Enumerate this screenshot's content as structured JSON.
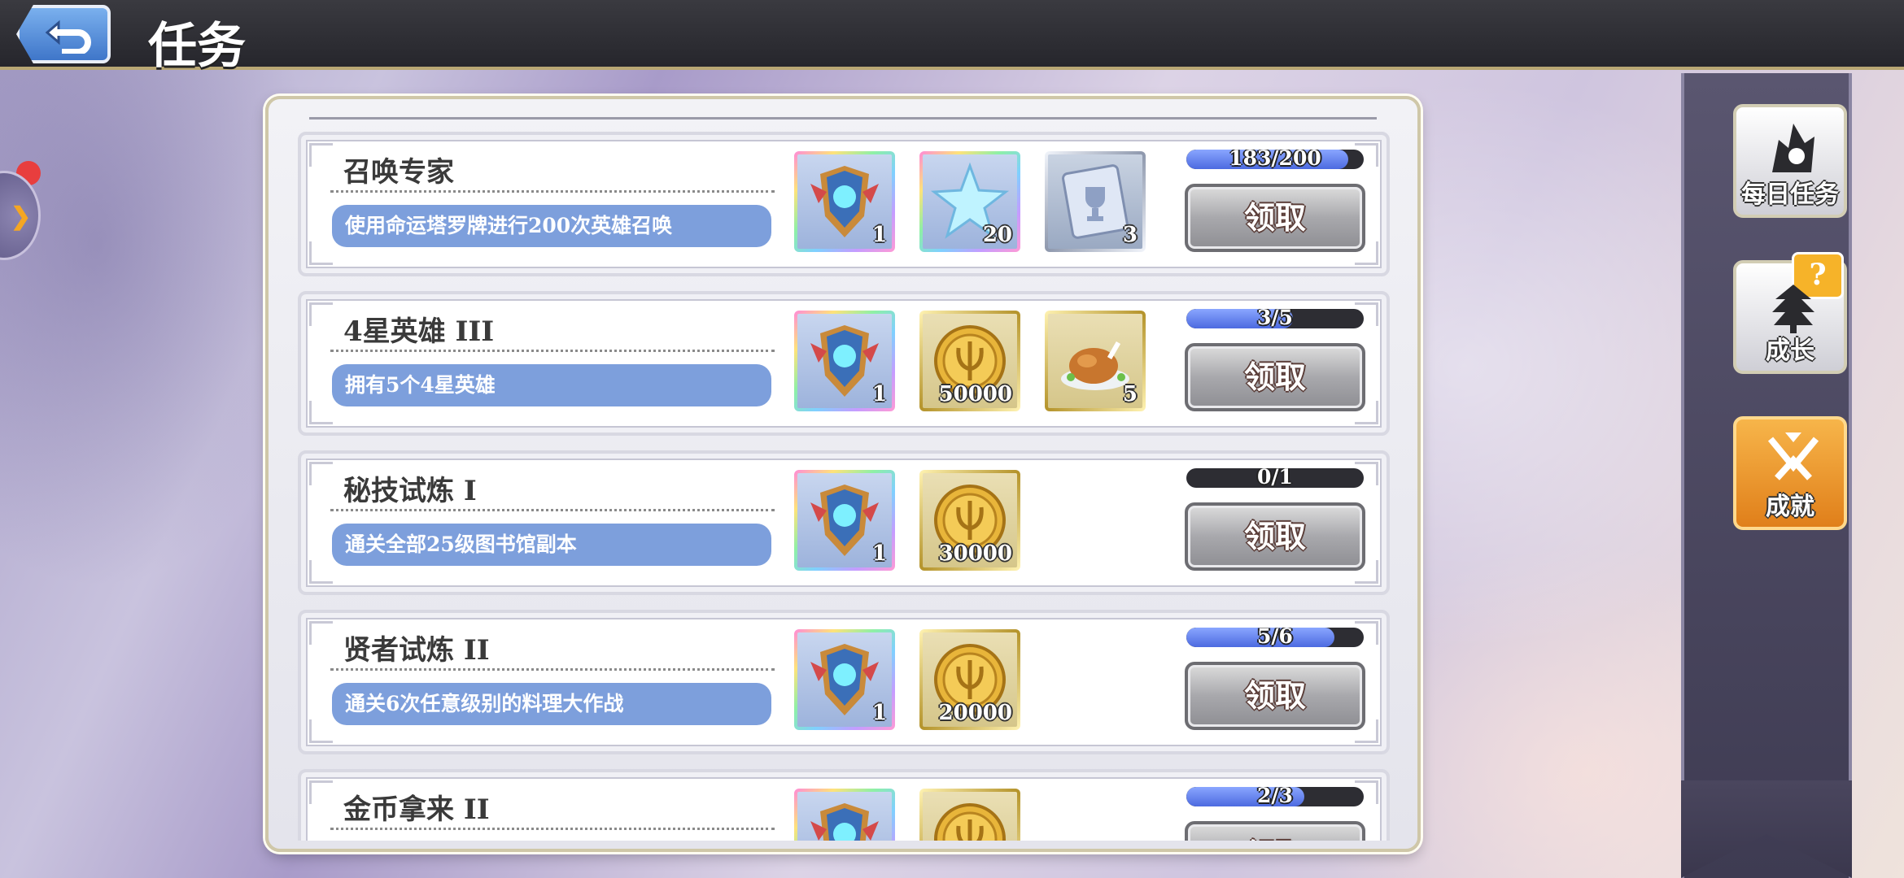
{
  "header": {
    "title": "任务",
    "back_icon": "back-arrow-icon"
  },
  "tasks": [
    {
      "name": "召唤专家",
      "desc": "使用命运塔罗牌进行200次英雄召唤",
      "progress": {
        "text": "183/200",
        "fraction": 0.915
      },
      "claim_label": "领取",
      "rewards": [
        {
          "icon": "summon-emblem-icon",
          "qty": "1",
          "frame": "rainbow"
        },
        {
          "icon": "star-crystal-icon",
          "qty": "20",
          "frame": "rainbow"
        },
        {
          "icon": "trophy-card-icon",
          "qty": "3",
          "frame": "silver"
        }
      ]
    },
    {
      "name": "4星英雄 III",
      "desc": "拥有5个4星英雄",
      "progress": {
        "text": "3/5",
        "fraction": 0.6
      },
      "claim_label": "领取",
      "rewards": [
        {
          "icon": "summon-emblem-icon",
          "qty": "1",
          "frame": "rainbow"
        },
        {
          "icon": "gold-coin-icon",
          "qty": "50000",
          "frame": "gold"
        },
        {
          "icon": "roast-chicken-icon",
          "qty": "5",
          "frame": "gold"
        }
      ]
    },
    {
      "name": "秘技试炼 I",
      "desc": "通关全部25级图书馆副本",
      "progress": {
        "text": "0/1",
        "fraction": 0
      },
      "claim_label": "领取",
      "rewards": [
        {
          "icon": "summon-emblem-icon",
          "qty": "1",
          "frame": "rainbow"
        },
        {
          "icon": "gold-coin-icon",
          "qty": "30000",
          "frame": "gold"
        }
      ]
    },
    {
      "name": "贤者试炼 II",
      "desc": "通关6次任意级别的料理大作战",
      "progress": {
        "text": "5/6",
        "fraction": 0.833
      },
      "claim_label": "领取",
      "rewards": [
        {
          "icon": "summon-emblem-icon",
          "qty": "1",
          "frame": "rainbow"
        },
        {
          "icon": "gold-coin-icon",
          "qty": "20000",
          "frame": "gold"
        }
      ]
    },
    {
      "name": "金币拿来 II",
      "desc": "",
      "progress": {
        "text": "2/3",
        "fraction": 0.667
      },
      "claim_label": "领取",
      "rewards": [
        {
          "icon": "summon-emblem-icon",
          "qty": "",
          "frame": "rainbow"
        },
        {
          "icon": "gold-coin-icon",
          "qty": "",
          "frame": "gold"
        }
      ]
    }
  ],
  "sidebar": {
    "daily": {
      "label": "每日任务",
      "icon": "daily-mission-icon"
    },
    "growth": {
      "label": "成长",
      "icon": "growth-tree-icon",
      "badge": "?"
    },
    "achievement": {
      "label": "成就",
      "icon": "achievement-swords-icon",
      "active": true
    }
  },
  "colors": {
    "accent": "#7d9fdc",
    "progress": "#5a78e8",
    "active_tab": "#f0a030"
  }
}
